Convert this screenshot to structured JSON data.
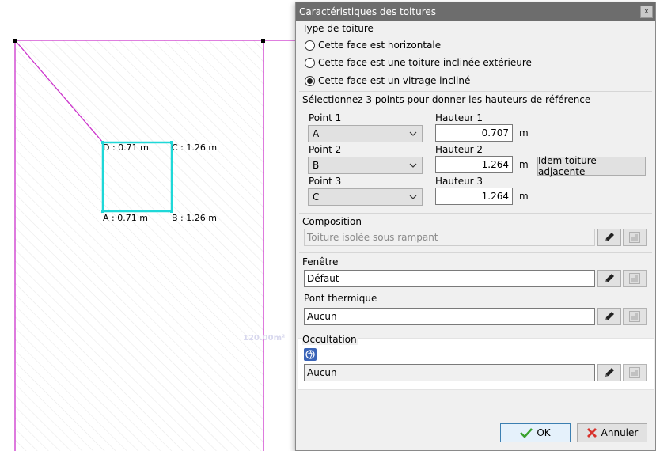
{
  "canvas": {
    "points": [
      {
        "id": "D",
        "label": "D : 0.71 m"
      },
      {
        "id": "C",
        "label": "C : 1.26 m"
      },
      {
        "id": "A",
        "label": "A : 0.71 m"
      },
      {
        "id": "B",
        "label": "B : 1.26 m"
      }
    ],
    "area_label": "120.00m²",
    "colors": {
      "wall": "#cc33cc",
      "selection": "#1fd8d8",
      "hatch": "#e6e6e6"
    }
  },
  "dialog": {
    "title": "Caractéristiques des toitures",
    "close_glyph": "x",
    "roof_type": {
      "title": "Type de toiture",
      "options": [
        {
          "label": "Cette face est horizontale",
          "checked": false
        },
        {
          "label": "Cette face est une toiture inclinée extérieure",
          "checked": false
        },
        {
          "label": "Cette face est un vitrage incliné",
          "checked": true
        }
      ]
    },
    "reference": {
      "title": "Sélectionnez 3 points pour donner les hauteurs de référence",
      "rows": [
        {
          "point_label": "Point 1",
          "point_value": "A",
          "height_label": "Hauteur 1",
          "height_value": "0.707",
          "unit": "m"
        },
        {
          "point_label": "Point 2",
          "point_value": "B",
          "height_label": "Hauteur 2",
          "height_value": "1.264",
          "unit": "m"
        },
        {
          "point_label": "Point 3",
          "point_value": "C",
          "height_label": "Hauteur 3",
          "height_value": "1.264",
          "unit": "m"
        }
      ],
      "adjacent_button": "Idem toiture adjacente"
    },
    "composition": {
      "title": "Composition",
      "value": "Toiture isolée sous rampant"
    },
    "fenetre": {
      "title": "Fenêtre",
      "value": "Défaut"
    },
    "pont": {
      "title": "Pont thermique",
      "value": "Aucun"
    },
    "occultation": {
      "title": "Occultation",
      "value": "Aucun"
    },
    "ok_label": "OK",
    "cancel_label": "Annuler",
    "icons": {
      "edit": "pencil-icon",
      "library": "library-icon",
      "ok": "check-icon",
      "cancel": "cross-icon",
      "occultation": "shutter-icon"
    }
  }
}
